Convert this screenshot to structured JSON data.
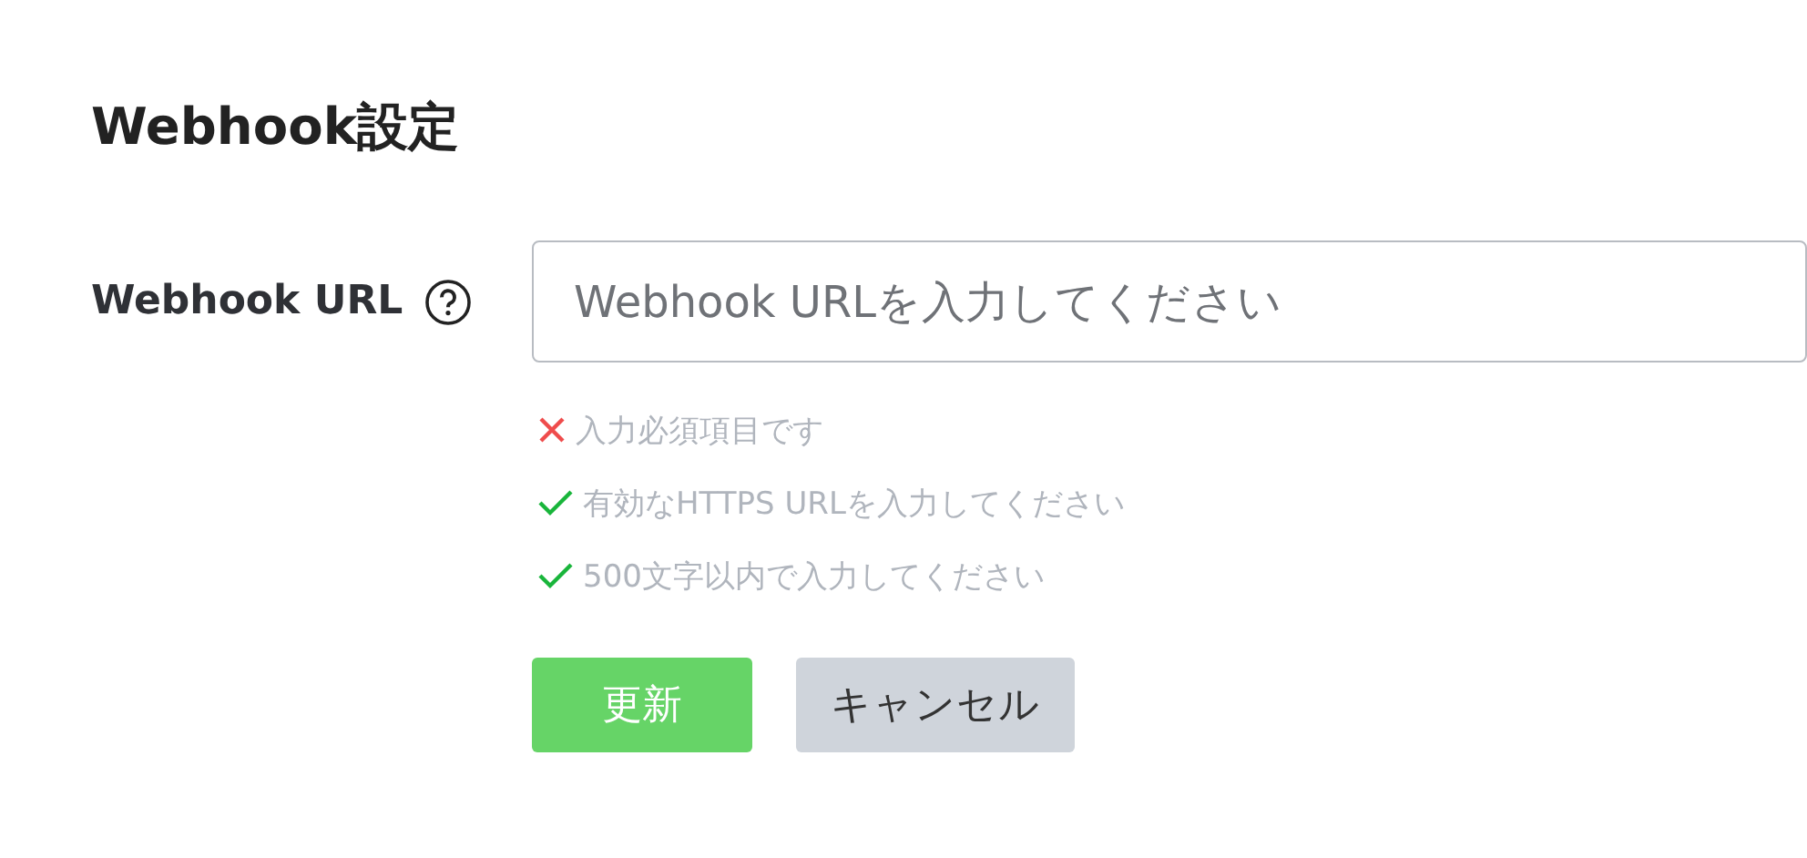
{
  "title": "Webhook設定",
  "field": {
    "label": "Webhook URL",
    "placeholder": "Webhook URLを入力してください"
  },
  "rules": [
    {
      "text": "入力必須項目です",
      "valid": false
    },
    {
      "text": "有効なHTTPS URLを入力してください",
      "valid": true
    },
    {
      "text": "500文字以内で入力してください",
      "valid": true
    }
  ],
  "buttons": [
    {
      "label": "更新",
      "kind": "primary"
    },
    {
      "label": "キャンセル",
      "kind": "secondary"
    }
  ]
}
